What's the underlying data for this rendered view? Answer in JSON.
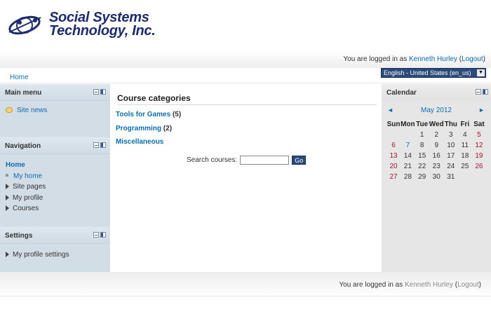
{
  "brand": {
    "line1": "Social Systems",
    "line2": "Technology, Inc."
  },
  "login": {
    "prefix": "You are logged in as",
    "user": "Kenneth Hurley",
    "logout": "Logout"
  },
  "breadcrumb": {
    "home": "Home"
  },
  "language": {
    "selected": "English - United States (en_us)"
  },
  "main_menu": {
    "title": "Main menu",
    "items": [
      {
        "label": "Site news"
      }
    ]
  },
  "navigation": {
    "title": "Navigation",
    "home": "Home",
    "items": [
      {
        "label": "My home"
      },
      {
        "label": "Site pages"
      },
      {
        "label": "My profile"
      },
      {
        "label": "Courses"
      }
    ]
  },
  "settings": {
    "title": "Settings",
    "items": [
      {
        "label": "My profile settings"
      }
    ]
  },
  "course_categories": {
    "title": "Course categories",
    "items": [
      {
        "name": "Tools for Games",
        "count": "(5)"
      },
      {
        "name": "Programming",
        "count": "(2)"
      },
      {
        "name": "Miscellaneous",
        "count": ""
      }
    ]
  },
  "search": {
    "label": "Search courses:",
    "button": "Go"
  },
  "calendar": {
    "title": "Calendar",
    "month": "May 2012",
    "weekdays": [
      "Sun",
      "Mon",
      "Tue",
      "Wed",
      "Thu",
      "Fri",
      "Sat"
    ],
    "weeks": [
      [
        "",
        "",
        "1",
        "2",
        "3",
        "4",
        "5"
      ],
      [
        "6",
        "7",
        "8",
        "9",
        "10",
        "11",
        "12"
      ],
      [
        "13",
        "14",
        "15",
        "16",
        "17",
        "18",
        "19"
      ],
      [
        "20",
        "21",
        "22",
        "23",
        "24",
        "25",
        "26"
      ],
      [
        "27",
        "28",
        "29",
        "30",
        "31",
        "",
        ""
      ]
    ],
    "event_days": [
      "7"
    ],
    "colors": {
      "weekend": "#a3142c",
      "link": "#0b6eaf"
    }
  },
  "footer": {
    "prefix": "You are logged in as",
    "user": "Kenneth Hurley",
    "logout": "Logout"
  },
  "theme": {
    "accent": "#0b6eaf",
    "block_bg": "#d3dde6",
    "brand_navy": "#1c2c6c"
  }
}
